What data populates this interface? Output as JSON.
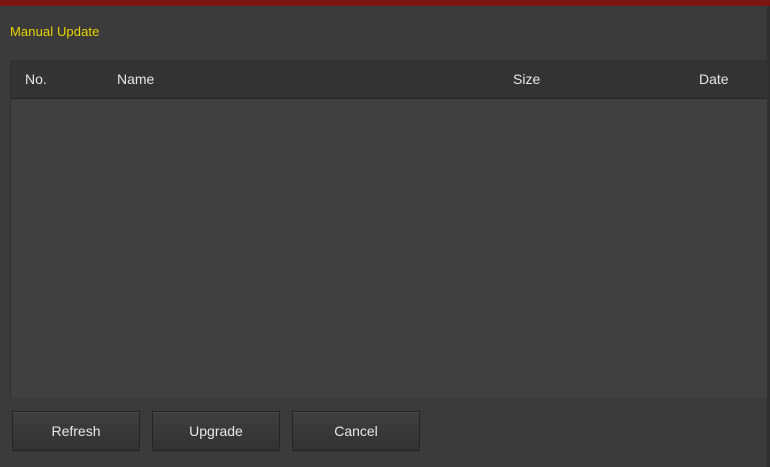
{
  "header": {
    "title": "Manual Update"
  },
  "table": {
    "columns": {
      "no": "No.",
      "name": "Name",
      "size": "Size",
      "date": "Date"
    },
    "rows": []
  },
  "buttons": {
    "refresh": "Refresh",
    "upgrade": "Upgrade",
    "cancel": "Cancel"
  }
}
